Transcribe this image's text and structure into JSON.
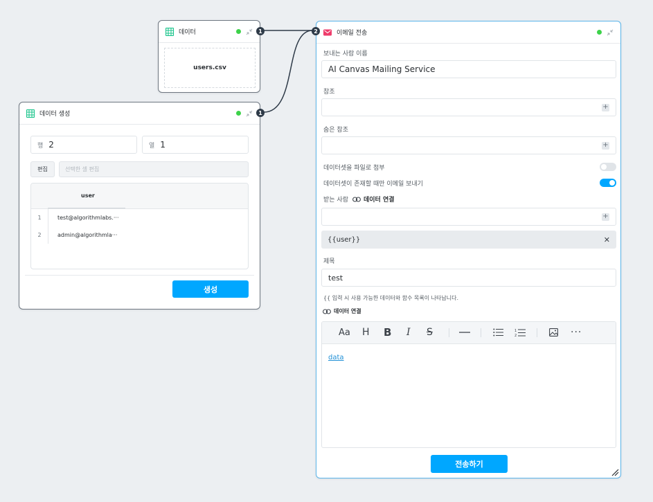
{
  "data_node": {
    "title": "데이터",
    "file_name": "users.csv",
    "out_port": "1"
  },
  "gen_node": {
    "title": "데이터 생성",
    "rows_label": "행",
    "rows_value": "2",
    "cols_label": "열",
    "cols_value": "1",
    "edit_button": "편집",
    "edit_placeholder": "선택한 셀 편집",
    "table": {
      "header": "user",
      "rows": [
        {
          "num": "1",
          "value": "test@algorithmlabs.···"
        },
        {
          "num": "2",
          "value": "admin@algorithmla···"
        }
      ]
    },
    "generate_button": "생성",
    "out_port": "1"
  },
  "email_node": {
    "title": "이메일 전송",
    "in_port": "2",
    "sender_label": "보내는 사람 이름",
    "sender_value": "AI Canvas Mailing Service",
    "cc_label": "참조",
    "bcc_label": "숨은 참조",
    "attach_label": "데이터셋을 파일로 첨부",
    "attach_on": false,
    "only_exist_label": "데이터셋이 존재할 때만 이메일 보내기",
    "only_exist_on": true,
    "recipient_label": "받는 사람",
    "link_label": "데이터 연결",
    "recipient_tag": "{{user}}",
    "subject_label": "제목",
    "subject_value": "test",
    "hint": "{{ 입력 시 사용 가능한 데이터와 함수 목록이 나타납니다.",
    "link_label2": "데이터 연결",
    "editor_text": "data",
    "send_button": "전송하기",
    "accent_color": "#00a7ff",
    "toolbar": [
      "text-size-icon",
      "heading-icon",
      "bold-icon",
      "italic-icon",
      "strikethrough-icon",
      "horizontal-rule-icon",
      "bullet-list-icon",
      "ordered-list-icon",
      "image-icon",
      "more-icon"
    ]
  }
}
